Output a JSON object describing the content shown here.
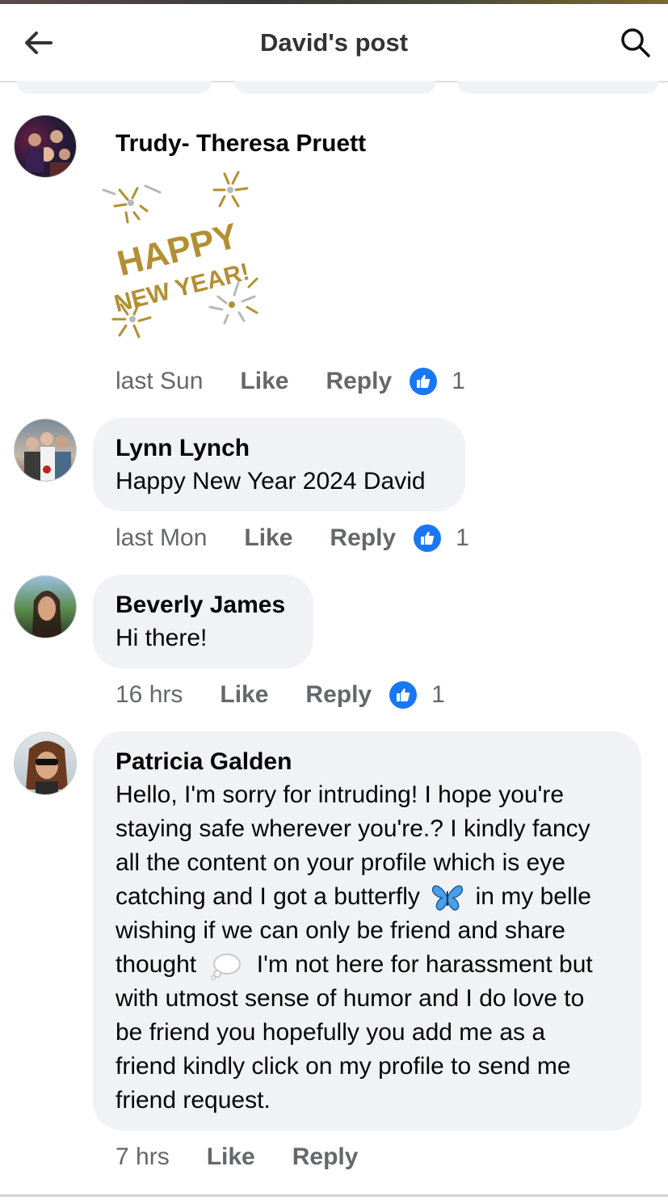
{
  "header": {
    "title": "David's post",
    "back_icon": "arrow-left-icon",
    "search_icon": "search-icon"
  },
  "colors": {
    "accent": "#1877f2",
    "bubble": "#f0f2f5",
    "secondary_text": "#65676b",
    "sticker_gold": "#b38f32",
    "sticker_silver": "#b8b8b8"
  },
  "comments": [
    {
      "author": "Trudy- Theresa Pruett",
      "sticker": {
        "line1": "HAPPY",
        "line2": "NEW YEAR!"
      },
      "time": "last Sun",
      "like_label": "Like",
      "reply_label": "Reply",
      "reactions": "1"
    },
    {
      "author": "Lynn Lynch",
      "text": "Happy New Year 2024 David",
      "time": "last Mon",
      "like_label": "Like",
      "reply_label": "Reply",
      "reactions": "1"
    },
    {
      "author": "Beverly James",
      "text": "Hi there!",
      "time": "16 hrs",
      "like_label": "Like",
      "reply_label": "Reply",
      "reactions": "1"
    },
    {
      "author": "Patricia Galden",
      "lines": [
        "Hello, I'm sorry for intruding! I hope you're",
        "staying safe wherever you're.? I kindly fancy",
        "all the content on your profile which is eye",
        "catching and I got a butterfly",
        "in my belle",
        "wishing if we can only be friend and share",
        "thought",
        "I'm not here for harassment but",
        "with utmost sense of humor and I do love to",
        "be friend you hopefully you add me as a",
        "friend kindly click on my profile to send me",
        "friend request."
      ],
      "time": "7 hrs",
      "like_label": "Like",
      "reply_label": "Reply"
    }
  ]
}
